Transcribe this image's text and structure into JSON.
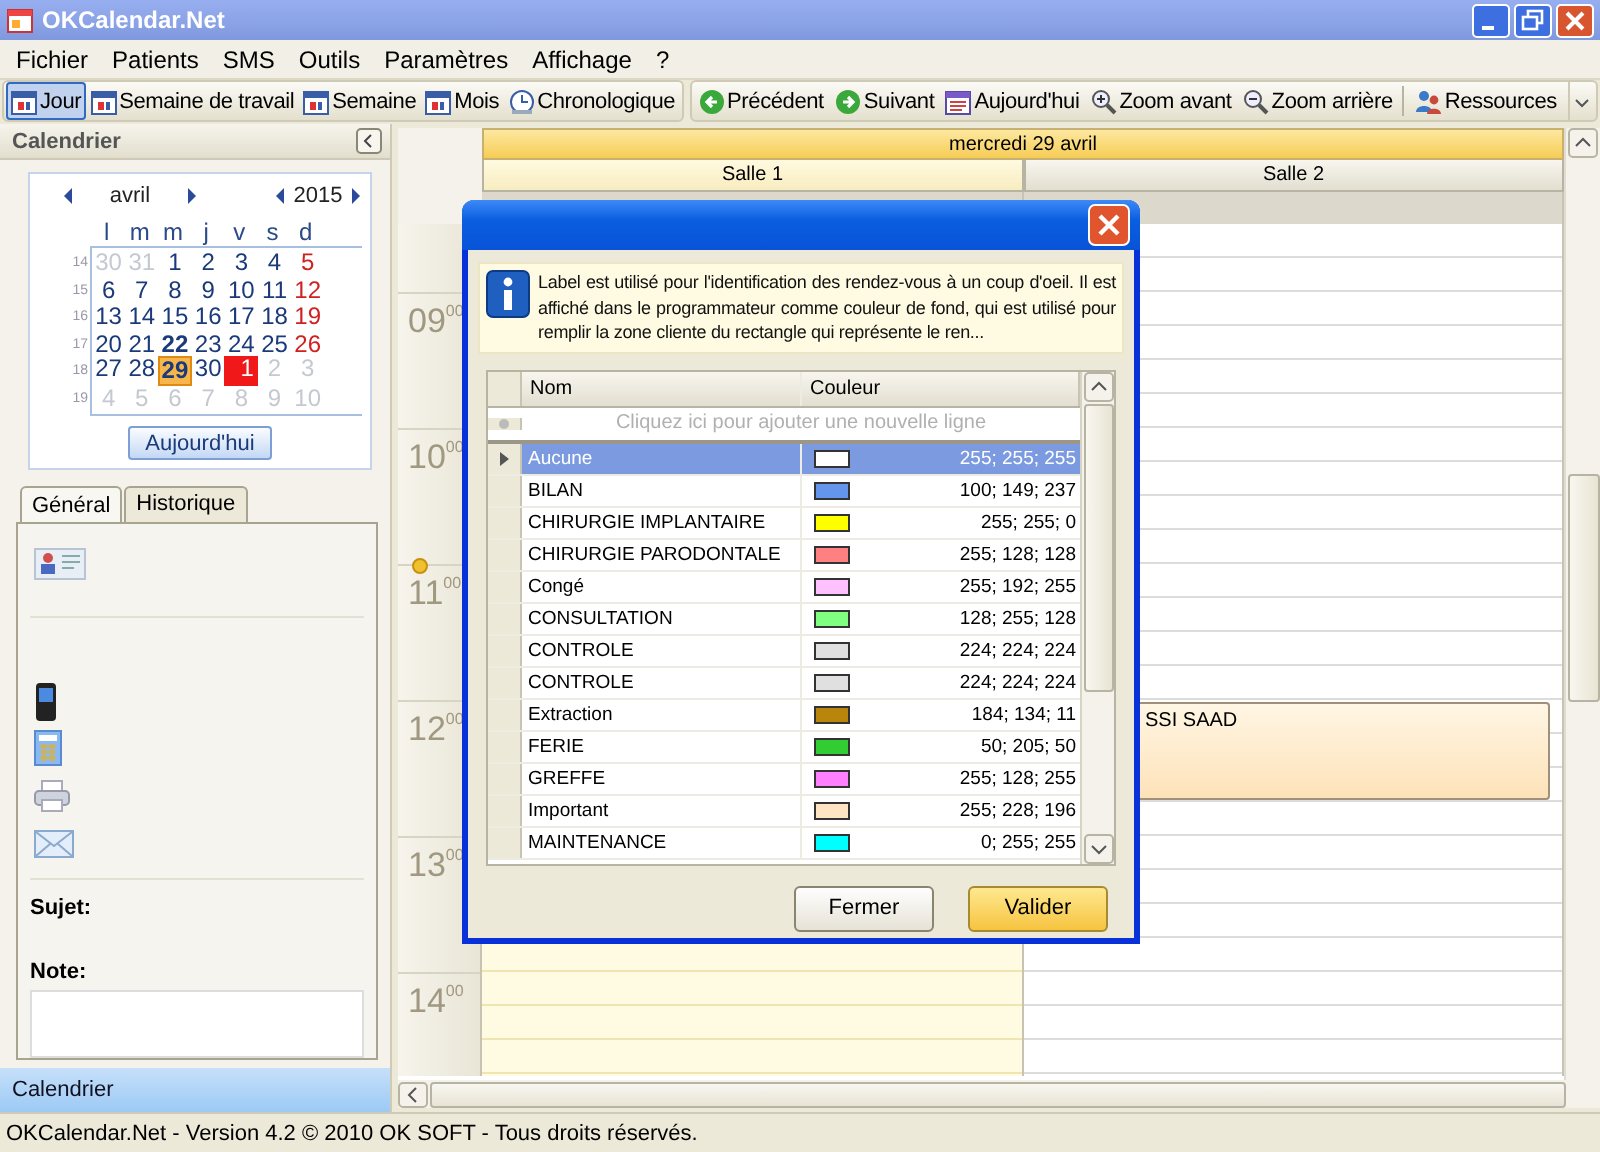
{
  "window": {
    "title": "OKCalendar.Net"
  },
  "menu": [
    "Fichier",
    "Patients",
    "SMS",
    "Outils",
    "Paramètres",
    "Affichage",
    "?"
  ],
  "view_buttons": [
    {
      "label": "Jour",
      "kind": "calendar",
      "selected": true
    },
    {
      "label": "Semaine de travail",
      "kind": "calendar",
      "selected": false
    },
    {
      "label": "Semaine",
      "kind": "calendar",
      "selected": false
    },
    {
      "label": "Mois",
      "kind": "calendar",
      "selected": false
    },
    {
      "label": "Chronologique",
      "kind": "clock",
      "selected": false
    }
  ],
  "nav_buttons": [
    {
      "label": "Précédent",
      "kind": "previous"
    },
    {
      "label": "Suivant",
      "kind": "next"
    },
    {
      "label": "Aujourd'hui",
      "kind": "today"
    },
    {
      "label": "Zoom avant",
      "kind": "zoom-in"
    },
    {
      "label": "Zoom arrière",
      "kind": "zoom-out"
    },
    {
      "label": "Ressources",
      "kind": "resources"
    }
  ],
  "sidebar": {
    "title": "Calendrier",
    "mini_calendar": {
      "month": "avril",
      "year": "2015",
      "weekdays": [
        "l",
        "m",
        "m",
        "j",
        "v",
        "s",
        "d"
      ],
      "weeks": [
        {
          "number": "14",
          "days": [
            {
              "day": "30",
              "kind": "other"
            },
            {
              "day": "31",
              "kind": "other"
            },
            {
              "day": "1",
              "kind": "day"
            },
            {
              "day": "2",
              "kind": "day"
            },
            {
              "day": "3",
              "kind": "day"
            },
            {
              "day": "4",
              "kind": "day"
            },
            {
              "day": "5",
              "kind": "sunday"
            }
          ]
        },
        {
          "number": "15",
          "days": [
            {
              "day": "6",
              "kind": "day"
            },
            {
              "day": "7",
              "kind": "day"
            },
            {
              "day": "8",
              "kind": "day"
            },
            {
              "day": "9",
              "kind": "day"
            },
            {
              "day": "10",
              "kind": "day"
            },
            {
              "day": "11",
              "kind": "day"
            },
            {
              "day": "12",
              "kind": "sunday"
            }
          ]
        },
        {
          "number": "16",
          "days": [
            {
              "day": "13",
              "kind": "day"
            },
            {
              "day": "14",
              "kind": "day"
            },
            {
              "day": "15",
              "kind": "day"
            },
            {
              "day": "16",
              "kind": "day"
            },
            {
              "day": "17",
              "kind": "day"
            },
            {
              "day": "18",
              "kind": "day"
            },
            {
              "day": "19",
              "kind": "sunday"
            }
          ]
        },
        {
          "number": "17",
          "days": [
            {
              "day": "20",
              "kind": "day"
            },
            {
              "day": "21",
              "kind": "day"
            },
            {
              "day": "22",
              "kind": "marked"
            },
            {
              "day": "23",
              "kind": "day"
            },
            {
              "day": "24",
              "kind": "day"
            },
            {
              "day": "25",
              "kind": "day"
            },
            {
              "day": "26",
              "kind": "sunday"
            }
          ]
        },
        {
          "number": "18",
          "days": [
            {
              "day": "27",
              "kind": "day"
            },
            {
              "day": "28",
              "kind": "day"
            },
            {
              "day": "29",
              "kind": "today"
            },
            {
              "day": "30",
              "kind": "day"
            },
            {
              "day": "1",
              "kind": "holiday"
            },
            {
              "day": "2",
              "kind": "other"
            },
            {
              "day": "3",
              "kind": "other"
            }
          ]
        },
        {
          "number": "19",
          "days": [
            {
              "day": "4",
              "kind": "other"
            },
            {
              "day": "5",
              "kind": "other"
            },
            {
              "day": "6",
              "kind": "other"
            },
            {
              "day": "7",
              "kind": "other"
            },
            {
              "day": "8",
              "kind": "other"
            },
            {
              "day": "9",
              "kind": "other"
            },
            {
              "day": "10",
              "kind": "other"
            }
          ]
        }
      ],
      "today_button": "Aujourd'hui"
    },
    "tabs": [
      {
        "label": "Général",
        "selected": true
      },
      {
        "label": "Historique",
        "selected": false
      }
    ],
    "subject_label": "Sujet:",
    "note_label": "Note:",
    "navigation_bar": "Calendrier"
  },
  "scheduler": {
    "date": "mercredi 29 avril",
    "hours": [
      {
        "hour": "09",
        "minutes": "00",
        "current": false
      },
      {
        "hour": "10",
        "minutes": "00",
        "current": false
      },
      {
        "hour": "11",
        "minutes": "00",
        "current": true
      },
      {
        "hour": "12",
        "minutes": "00",
        "current": false
      },
      {
        "hour": "13",
        "minutes": "00",
        "current": false
      },
      {
        "hour": "14",
        "minutes": "00",
        "current": false
      }
    ],
    "resources": [
      {
        "name": "Salle 1",
        "selected": true
      },
      {
        "name": "Salle 2",
        "selected": false,
        "appointments": [
          {
            "text": "SSI SAAD"
          }
        ]
      }
    ]
  },
  "dialog": {
    "info": "Label est utilisé pour l'identification des rendez-vous à un coup d'oeil. Il est affiché dans le programmateur comme couleur de fond, qui est utilisé pour remplir la zone cliente du rectangle qui représente le ren...",
    "columns": [
      "Nom",
      "Couleur"
    ],
    "new_row_hint": "Cliquez ici pour ajouter une nouvelle ligne",
    "rows": [
      {
        "name": "Aucune",
        "color": "#ffffff",
        "value": "255; 255; 255",
        "selected": true
      },
      {
        "name": "BILAN",
        "color": "#6495ed",
        "value": "100; 149; 237",
        "selected": false
      },
      {
        "name": "CHIRURGIE IMPLANTAIRE",
        "color": "#ffff00",
        "value": "255; 255; 0",
        "selected": false
      },
      {
        "name": "CHIRURGIE PARODONTALE",
        "color": "#ff8080",
        "value": "255; 128; 128",
        "selected": false
      },
      {
        "name": "Congé",
        "color": "#ffc0ff",
        "value": "255; 192; 255",
        "selected": false
      },
      {
        "name": "CONSULTATION",
        "color": "#80ff80",
        "value": "128; 255; 128",
        "selected": false
      },
      {
        "name": "CONTROLE",
        "color": "#e0e0e0",
        "value": "224; 224; 224",
        "selected": false
      },
      {
        "name": "CONTROLE",
        "color": "#e0e0e0",
        "value": "224; 224; 224",
        "selected": false
      },
      {
        "name": "Extraction",
        "color": "#b8860b",
        "value": "184; 134; 11",
        "selected": false
      },
      {
        "name": "FERIE",
        "color": "#32cd32",
        "value": "50; 205; 50",
        "selected": false
      },
      {
        "name": "GREFFE",
        "color": "#ff80ff",
        "value": "255; 128; 255",
        "selected": false
      },
      {
        "name": "Important",
        "color": "#ffe4c4",
        "value": "255; 228; 196",
        "selected": false
      },
      {
        "name": "MAINTENANCE",
        "color": "#00ffff",
        "value": "0; 255; 255",
        "selected": false
      }
    ],
    "buttons": [
      {
        "label": "Fermer",
        "kind": "secondary"
      },
      {
        "label": "Valider",
        "kind": "primary"
      }
    ]
  },
  "status_bar": "OKCalendar.Net - Version 4.2 © 2010 OK SOFT - Tous droits réservés."
}
